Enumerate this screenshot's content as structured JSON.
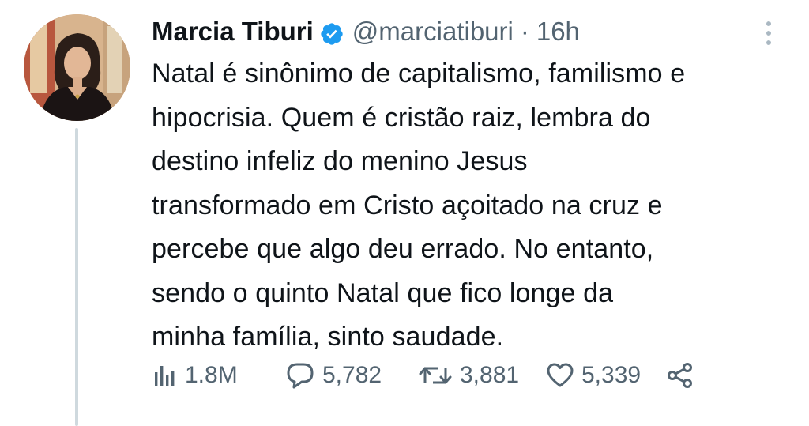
{
  "author": {
    "display_name": "Marcia Tiburi",
    "handle": "@marciatiburi",
    "separator": "·",
    "time_ago": "16h",
    "verified": true
  },
  "tweet": {
    "lines": [
      "Natal é sinônimo de capitalismo, familismo e",
      "hipocrisia. Quem é cristão raiz, lembra do",
      "destino infeliz do menino Jesus",
      "transformado em Cristo açoitado na cruz e",
      "percebe que algo deu errado. No entanto,",
      "sendo o quinto Natal que fico longe da",
      "minha família, sinto saudade."
    ]
  },
  "metrics": {
    "views": "1.8M",
    "replies": "5,782",
    "retweets": "3,881",
    "likes": "5,339"
  },
  "icons": {
    "verified": "verified-badge-icon",
    "more": "more-vertical-icon",
    "views": "bar-chart-icon",
    "reply": "speech-bubble-icon",
    "retweet": "retweet-arrows-icon",
    "like": "heart-icon",
    "share": "share-icon"
  },
  "colors": {
    "text": "#0f1419",
    "secondary": "#536471",
    "verified": "#1d9bf0",
    "thread_line": "#cfd9de"
  }
}
